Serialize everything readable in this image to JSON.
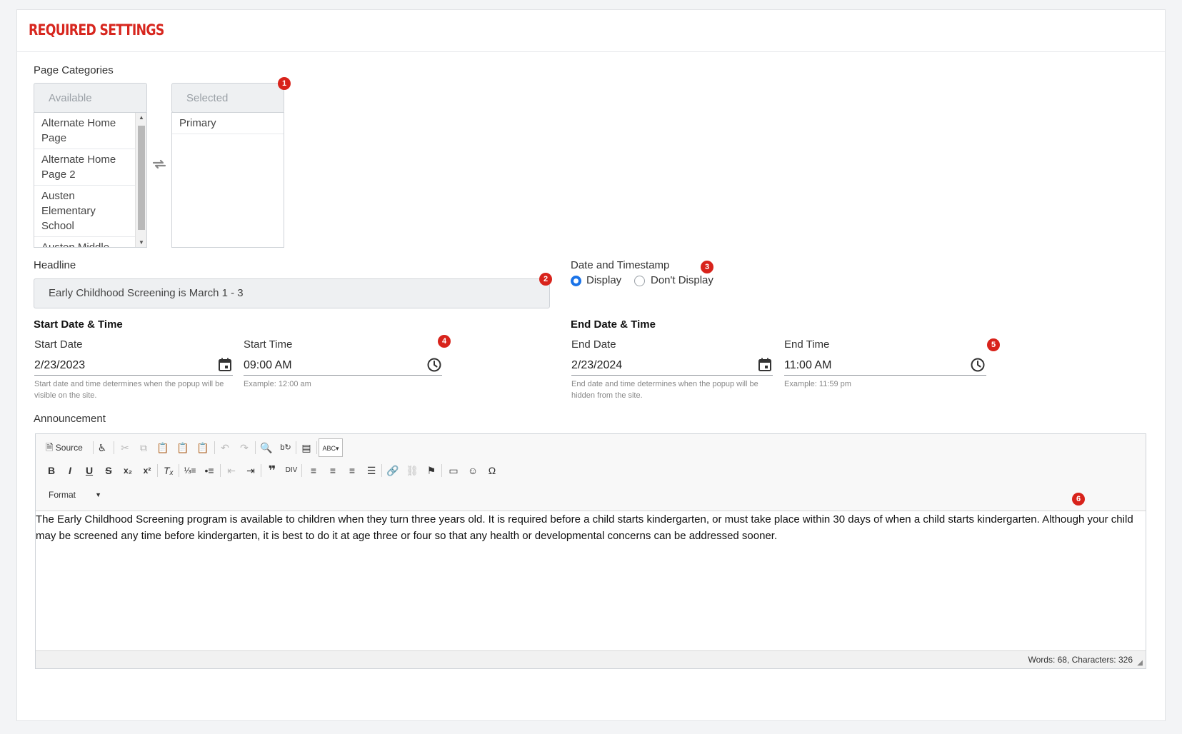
{
  "section": {
    "title": "REQUIRED SETTINGS"
  },
  "categories": {
    "label": "Page Categories",
    "available_header": "Available",
    "selected_header": "Selected",
    "available_items": [
      "Alternate Home Page",
      "Alternate Home Page 2",
      "Austen Elementary School",
      "Austen Middle School"
    ],
    "selected_items": [
      "Primary"
    ],
    "transfer_icon": "swap-arrows-icon"
  },
  "headline": {
    "label": "Headline",
    "value": "Early Childhood Screening is March 1 - 3"
  },
  "timestamp": {
    "label": "Date and Timestamp",
    "options": [
      "Display",
      "Don't Display"
    ],
    "selected": "Display"
  },
  "start": {
    "section_label": "Start Date & Time",
    "date_label": "Start Date",
    "date_value": "2/23/2023",
    "time_label": "Start Time",
    "time_value": "09:00 AM",
    "date_hint": "Start date and time determines when the popup will be visible on the site.",
    "time_hint": "Example: 12:00 am"
  },
  "end": {
    "section_label": "End Date & Time",
    "date_label": "End Date",
    "date_value": "2/23/2024",
    "time_label": "End Time",
    "time_value": "11:00 AM",
    "date_hint": "End date and time determines when the popup will be hidden from the site.",
    "time_hint": "Example: 11:59 pm"
  },
  "announcement": {
    "label": "Announcement",
    "toolbar": {
      "source_label": "Source",
      "format_label": "Format"
    },
    "content": "The Early Childhood Screening program is available to children when they turn three years old. It is required before a child starts kindergarten, or must take place within 30 days of when a child starts kindergarten. Although your child may be screened any time before kindergarten, it is best to do it at age three or four so that any health or developmental concerns can be addressed sooner.",
    "status": "Words: 68, Characters: 326"
  },
  "badges": [
    "1",
    "2",
    "3",
    "4",
    "5",
    "6"
  ],
  "colors": {
    "accent_red": "#d7261e",
    "radio_blue": "#1a73e8",
    "badge_red": "#d8231b"
  }
}
